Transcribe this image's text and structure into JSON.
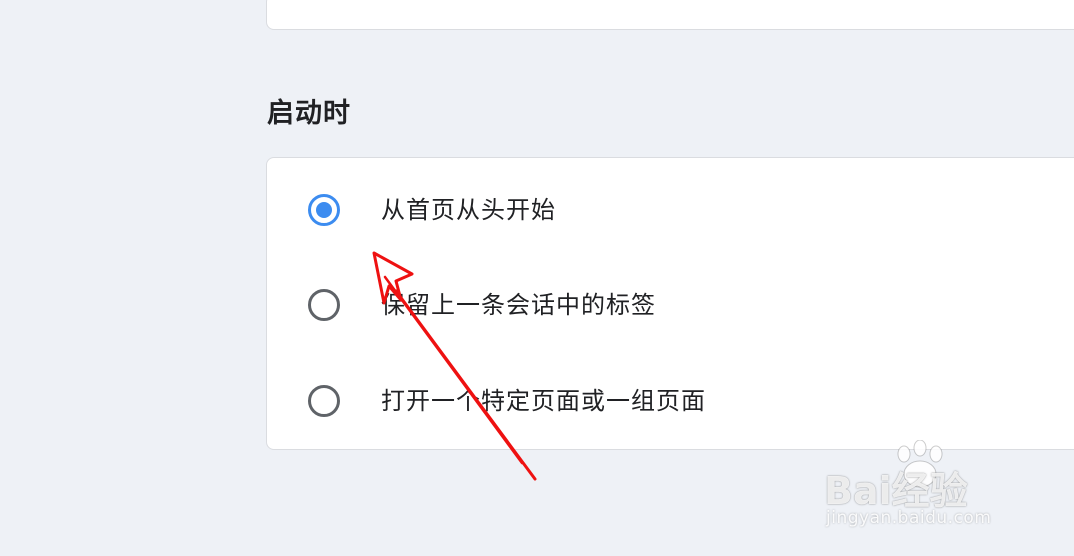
{
  "startup": {
    "title": "启动时",
    "options": [
      {
        "label": "从首页从头开始",
        "selected": true
      },
      {
        "label": "保留上一条会话中的标签",
        "selected": false
      },
      {
        "label": "打开一个特定页面或一组页面",
        "selected": false
      }
    ]
  },
  "watermark": {
    "brand": "Bai经验",
    "url": "jingyan.baidu.com"
  },
  "colors": {
    "accent": "#3c8cf0",
    "annotation_arrow": "#ee1111",
    "background": "#eef1f6"
  }
}
